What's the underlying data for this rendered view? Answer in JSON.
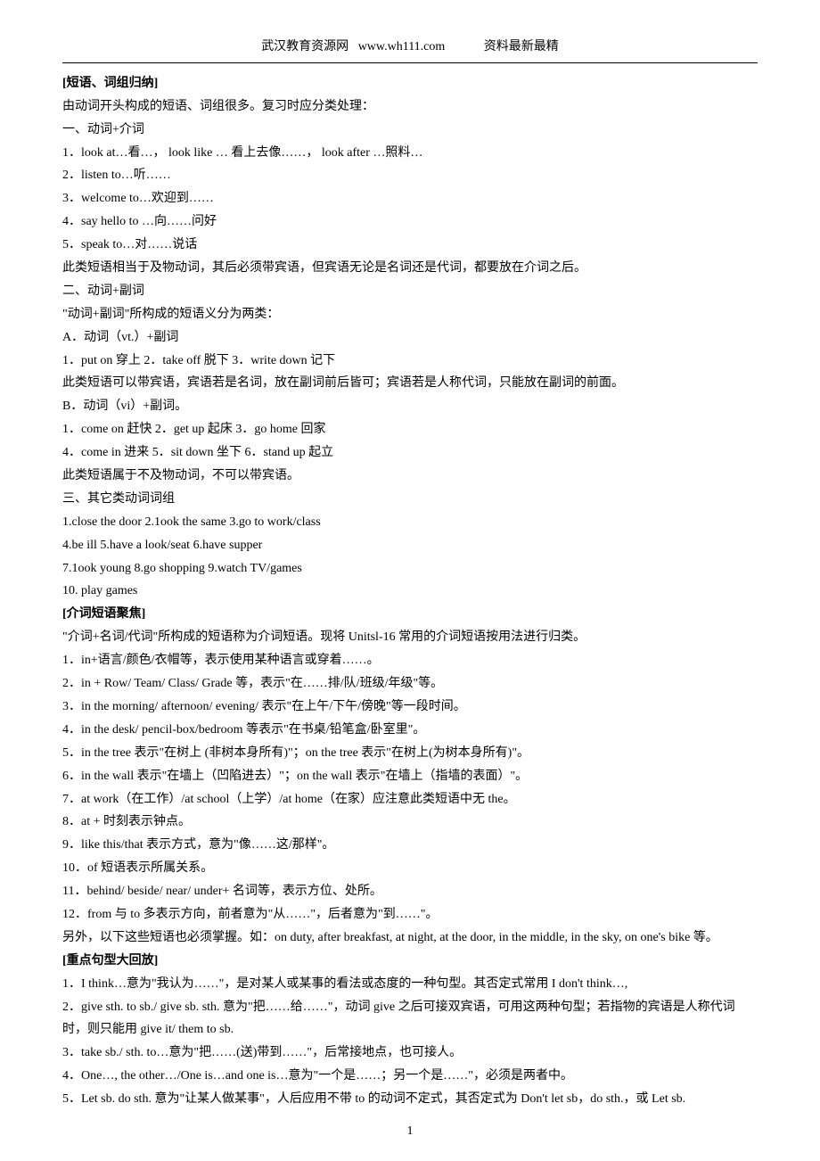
{
  "header": {
    "site_name": "武汉教育资源网",
    "site_url": "www.wh111.com",
    "note": "资料最新最精"
  },
  "sections": {
    "phrases": {
      "title": "[短语、词组归纳]",
      "intro": "由动词开头构成的短语、词组很多。复习时应分类处理：",
      "cat1_title": "一、动词+介词",
      "cat1_items": [
        "1．look at…看…，   look like … 看上去像……，   look after …照料…",
        "2．listen to…听……",
        "3．welcome to…欢迎到……",
        "4．say hello to …向……问好",
        "5．speak to…对……说话"
      ],
      "cat1_note": "此类短语相当于及物动词，其后必须带宾语，但宾语无论是名词还是代词，都要放在介词之后。",
      "cat2_title": "二、动词+副词",
      "cat2_intro": "\"动词+副词\"所构成的短语义分为两类：",
      "cat2_a_title": "A．动词（vt.）+副词",
      "cat2_a_line": "1．put on 穿上  2．take off 脱下  3．write down 记下",
      "cat2_a_note": "此类短语可以带宾语，宾语若是名词，放在副词前后皆可；宾语若是人称代词，只能放在副词的前面。",
      "cat2_b_title": "B．动词（vi）+副词。",
      "cat2_b_line1": "1．come on 赶快  2．get up 起床  3．go home 回家",
      "cat2_b_line2": "4．come in 进来  5．sit down 坐下  6．stand up 起立",
      "cat2_b_note": "此类短语属于不及物动词，不可以带宾语。",
      "cat3_title": "三、其它类动词词组",
      "cat3_lines": [
        "1.close the door 2.1ook the same 3.go to work/class",
        "4.be ill 5.have a look/seat 6.have supper",
        "7.1ook young 8.go shopping 9.watch TV/games",
        "10. play games"
      ]
    },
    "prep": {
      "title": "[介词短语聚焦]",
      "intro": "\"介词+名词/代词\"所构成的短语称为介词短语。现将 Unitsl-16 常用的介词短语按用法进行归类。",
      "items": [
        "1．in+语言/颜色/衣帽等，表示使用某种语言或穿着……。",
        "2．in + Row/ Team/ Class/ Grade 等，表示\"在……排/队/班级/年级\"等。",
        "3．in the morning/ afternoon/ evening/  表示\"在上午/下午/傍晚\"等一段时间。",
        "4．in the desk/ pencil-box/bedroom  等表示\"在书桌/铅笔盒/卧室里\"。",
        "5．in the tree 表示\"在树上 (非树本身所有)\"；on the tree 表示\"在树上(为树本身所有)\"。",
        "6．in the wall 表示\"在墙上（凹陷进去）\"；on the wall 表示\"在墙上（指墙的表面）\"。",
        "7．at work（在工作）/at school（上学）/at home（在家）应注意此类短语中无 the。",
        "8．at + 时刻表示钟点。",
        "9．like this/that 表示方式，意为\"像……这/那样\"。",
        "10．of 短语表示所属关系。",
        "11．behind/ beside/ near/ under+ 名词等，表示方位、处所。",
        "12．from 与 to 多表示方向，前者意为\"从……\"，后者意为\"到……\"。"
      ],
      "extra": "另外，以下这些短语也必须掌握。如：on duty, after breakfast, at night, at the door, in the middle, in the sky, on one's bike 等。"
    },
    "sentences": {
      "title": "[重点句型大回放]",
      "items": [
        "1．I think…意为\"我认为……\"，是对某人或某事的看法或态度的一种句型。其否定式常用 I don't think…,",
        "2．give sth. to sb./ give sb. sth. 意为\"把……给……\"，动词 give 之后可接双宾语，可用这两种句型；若指物的宾语是人称代词时，则只能用 give it/ them to sb.",
        "3．take sb./ sth. to…意为\"把……(送)带到……\"，后常接地点，也可接人。",
        "4．One…, the other…/One is…and one is…意为\"一个是……；另一个是……\"，必须是两者中。",
        "5．Let sb. do sth. 意为\"让某人做某事\"，人后应用不带 to 的动词不定式，其否定式为 Don't let sb，do sth.，或 Let sb."
      ]
    }
  },
  "page_number": "1"
}
